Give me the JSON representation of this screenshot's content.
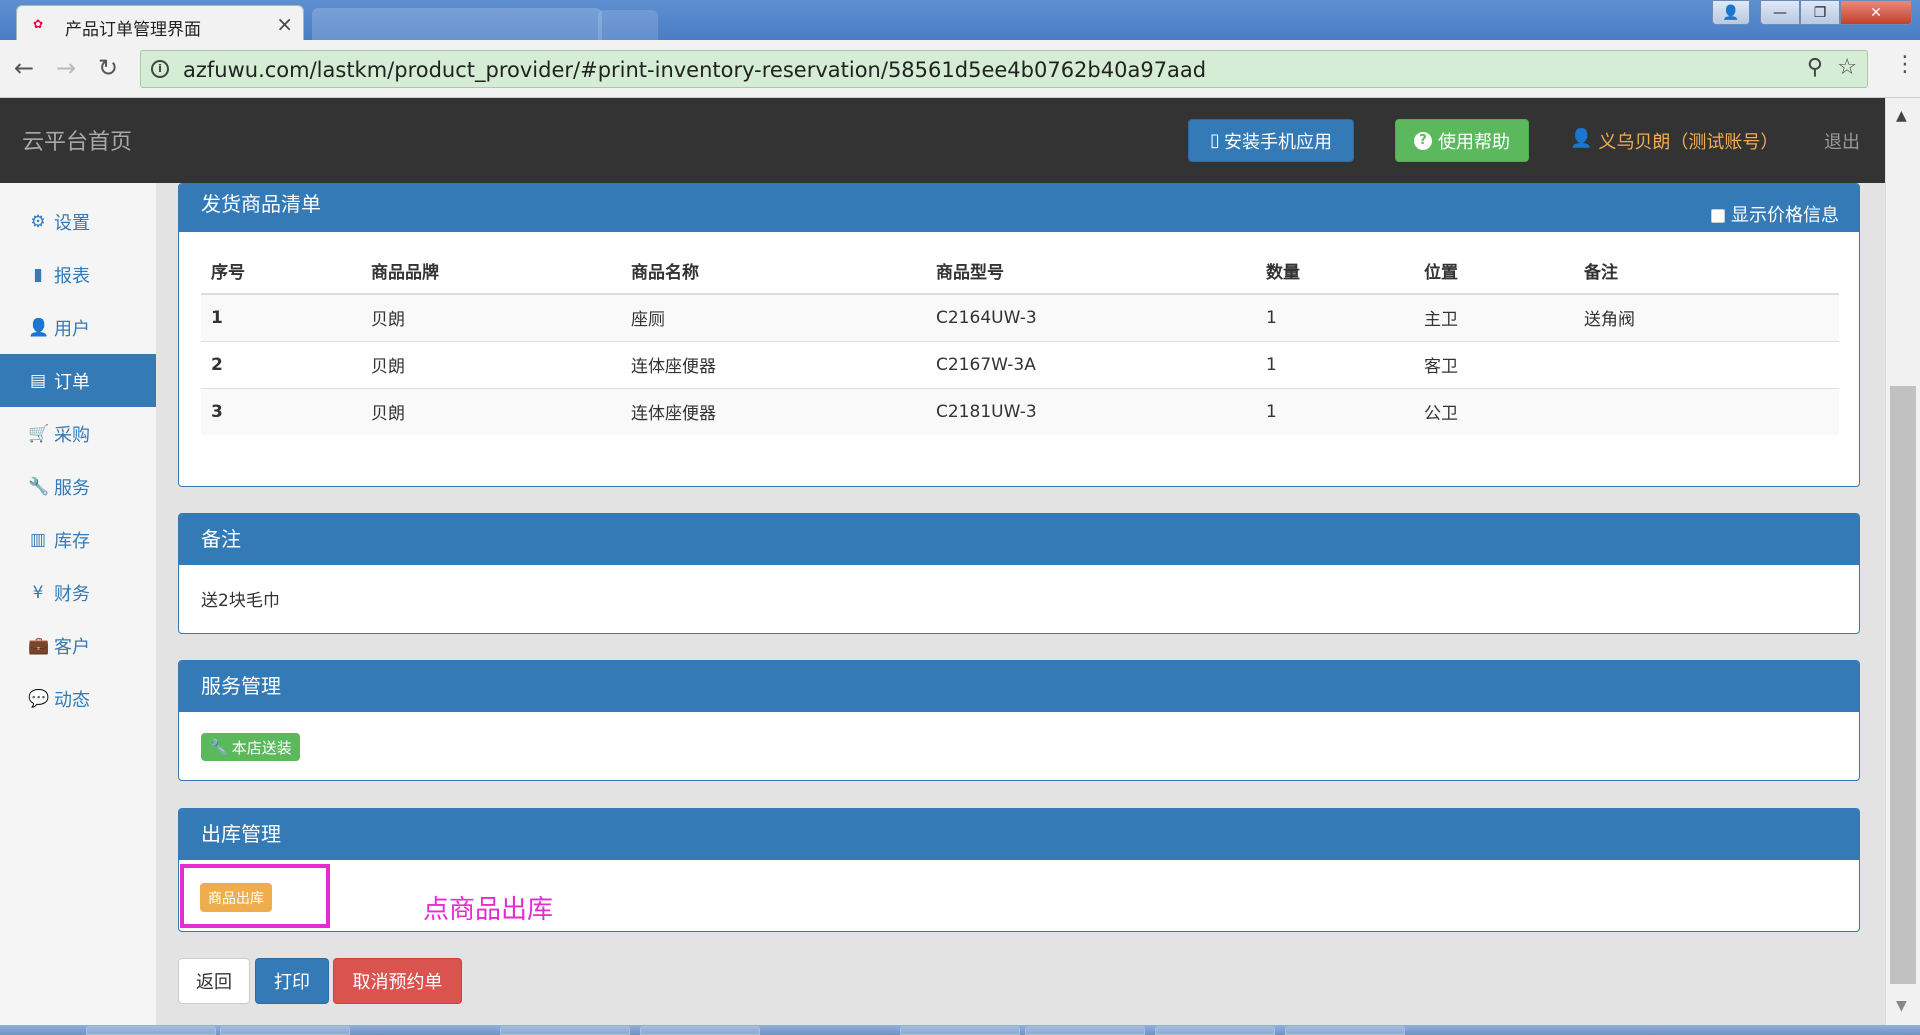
{
  "browser": {
    "active_tab_title": "产品订单管理界面",
    "url": "azfuwu.com/lastkm/product_provider/#print-inventory-reservation/58561d5ee4b0762b40a97aad"
  },
  "header": {
    "brand": "云平台首页",
    "install_app": "安装手机应用",
    "help": "使用帮助",
    "user": "义乌贝朗（测试账号）",
    "logout": "退出"
  },
  "sidebar": {
    "items": [
      {
        "label": "设置",
        "icon": "gear-icon"
      },
      {
        "label": "报表",
        "icon": "bar-chart-icon"
      },
      {
        "label": "用户",
        "icon": "user-icon"
      },
      {
        "label": "订单",
        "icon": "list-icon",
        "active": true
      },
      {
        "label": "采购",
        "icon": "cart-icon"
      },
      {
        "label": "服务",
        "icon": "wrench-icon"
      },
      {
        "label": "库存",
        "icon": "barcode-icon"
      },
      {
        "label": "财务",
        "icon": "yen-icon"
      },
      {
        "label": "客户",
        "icon": "briefcase-icon"
      },
      {
        "label": "动态",
        "icon": "comment-icon"
      }
    ]
  },
  "shipment_panel": {
    "title": "发货商品清单",
    "show_price_label": "显示价格信息",
    "columns": [
      "序号",
      "商品品牌",
      "商品名称",
      "商品型号",
      "数量",
      "位置",
      "备注"
    ],
    "rows": [
      [
        "1",
        "贝朗",
        "座厕",
        "C2164UW-3",
        "1",
        "主卫",
        "送角阀"
      ],
      [
        "2",
        "贝朗",
        "连体座便器",
        "C2167W-3A",
        "1",
        "客卫",
        ""
      ],
      [
        "3",
        "贝朗",
        "连体座便器",
        "C2181UW-3",
        "1",
        "公卫",
        ""
      ]
    ]
  },
  "notes_panel": {
    "title": "备注",
    "text": "送2块毛巾"
  },
  "service_panel": {
    "title": "服务管理",
    "label": "本店送装"
  },
  "outbound_panel": {
    "title": "出库管理",
    "button": "商品出库",
    "annotation": "点商品出库"
  },
  "actions": {
    "back": "返回",
    "print": "打印",
    "cancel": "取消预约单"
  },
  "colors": {
    "primary": "#337ab7",
    "success": "#5cb85c",
    "warning": "#f0ad4e",
    "danger": "#d9534f",
    "annotation": "#e62bd4"
  }
}
